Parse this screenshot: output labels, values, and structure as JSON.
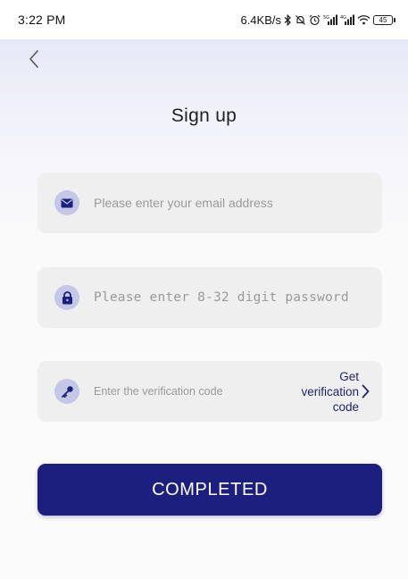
{
  "status_bar": {
    "time": "3:22 PM",
    "network_speed": "6.4KB/s",
    "battery_level": "45",
    "icons": [
      "bluetooth-icon",
      "mute-icon",
      "alarm-icon",
      "signal-icon",
      "signal-icon",
      "wifi-icon",
      "battery-icon"
    ]
  },
  "header": {
    "back_icon": "chevron-left-icon",
    "title": "Sign up"
  },
  "form": {
    "email": {
      "icon": "envelope-icon",
      "placeholder": "Please enter your email address",
      "value": ""
    },
    "password": {
      "icon": "lock-icon",
      "placeholder": "Please enter 8-32 digit password",
      "value": ""
    },
    "verification": {
      "icon": "key-icon",
      "placeholder": "Enter the verification code",
      "value": "",
      "get_code_label": "Get verification code",
      "get_code_icon": "chevron-right-icon"
    }
  },
  "submit": {
    "label": "COMPLETED"
  },
  "colors": {
    "accent": "#1c1f7e",
    "icon_background": "#c4c7e6",
    "field_background": "#efefef",
    "link_text": "#1f2566"
  }
}
